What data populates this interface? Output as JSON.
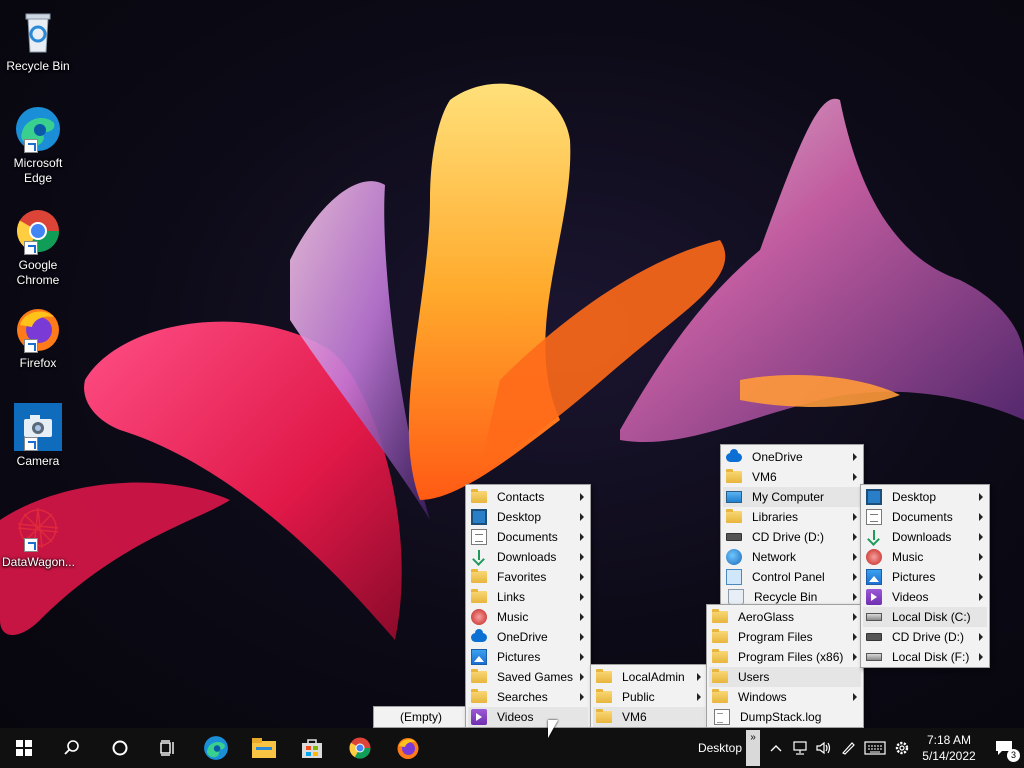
{
  "desktop_icons": [
    {
      "label": "Recycle Bin",
      "icon": "recycle-bin-icon"
    },
    {
      "label": "Microsoft Edge",
      "icon": "edge-icon"
    },
    {
      "label": "Google Chrome",
      "icon": "chrome-icon"
    },
    {
      "label": "Firefox",
      "icon": "firefox-icon"
    },
    {
      "label": "Camera",
      "icon": "camera-icon"
    },
    {
      "label": "DataWagon...",
      "icon": "datawagon-icon"
    }
  ],
  "menus": {
    "user_folders": {
      "items": [
        {
          "label": "Contacts",
          "icon": "folder"
        },
        {
          "label": "Desktop",
          "icon": "desktop"
        },
        {
          "label": "Documents",
          "icon": "docs"
        },
        {
          "label": "Downloads",
          "icon": "download"
        },
        {
          "label": "Favorites",
          "icon": "folder"
        },
        {
          "label": "Links",
          "icon": "folder"
        },
        {
          "label": "Music",
          "icon": "music"
        },
        {
          "label": "OneDrive",
          "icon": "cloud"
        },
        {
          "label": "Pictures",
          "icon": "pictures"
        },
        {
          "label": "Saved Games",
          "icon": "folder"
        },
        {
          "label": "Searches",
          "icon": "folder"
        },
        {
          "label": "Videos",
          "icon": "video"
        }
      ]
    },
    "empty_label": "(Empty)",
    "users": {
      "items": [
        {
          "label": "LocalAdmin",
          "icon": "folder"
        },
        {
          "label": "Public",
          "icon": "folder"
        },
        {
          "label": "VM6",
          "icon": "folder"
        }
      ]
    },
    "desktop_root": {
      "items": [
        {
          "label": "OneDrive",
          "icon": "cloud"
        },
        {
          "label": "VM6",
          "icon": "folder"
        },
        {
          "label": "My Computer",
          "icon": "monitor"
        },
        {
          "label": "Libraries",
          "icon": "folder"
        },
        {
          "label": "CD Drive (D:)",
          "icon": "cd"
        },
        {
          "label": "Network",
          "icon": "network"
        },
        {
          "label": "Control Panel",
          "icon": "cpanel"
        },
        {
          "label": "Recycle Bin",
          "icon": "recycle"
        }
      ]
    },
    "c_drive": {
      "items": [
        {
          "label": "AeroGlass",
          "icon": "folder"
        },
        {
          "label": "Program Files",
          "icon": "folder"
        },
        {
          "label": "Program Files (x86)",
          "icon": "folder"
        },
        {
          "label": "Users",
          "icon": "folder"
        },
        {
          "label": "Windows",
          "icon": "folder"
        },
        {
          "label": "DumpStack.log",
          "icon": "log"
        }
      ]
    },
    "my_computer": {
      "items": [
        {
          "label": "Desktop",
          "icon": "desktop"
        },
        {
          "label": "Documents",
          "icon": "docs"
        },
        {
          "label": "Downloads",
          "icon": "download"
        },
        {
          "label": "Music",
          "icon": "music"
        },
        {
          "label": "Pictures",
          "icon": "pictures"
        },
        {
          "label": "Videos",
          "icon": "video"
        },
        {
          "label": "Local Disk (C:)",
          "icon": "disk"
        },
        {
          "label": "CD Drive (D:)",
          "icon": "cd"
        },
        {
          "label": "Local Disk (F:)",
          "icon": "disk"
        }
      ]
    }
  },
  "taskbar": {
    "desktop_label": "Desktop",
    "chevron": "»",
    "time": "7:18 AM",
    "date": "5/14/2022",
    "notification_count": "3"
  }
}
